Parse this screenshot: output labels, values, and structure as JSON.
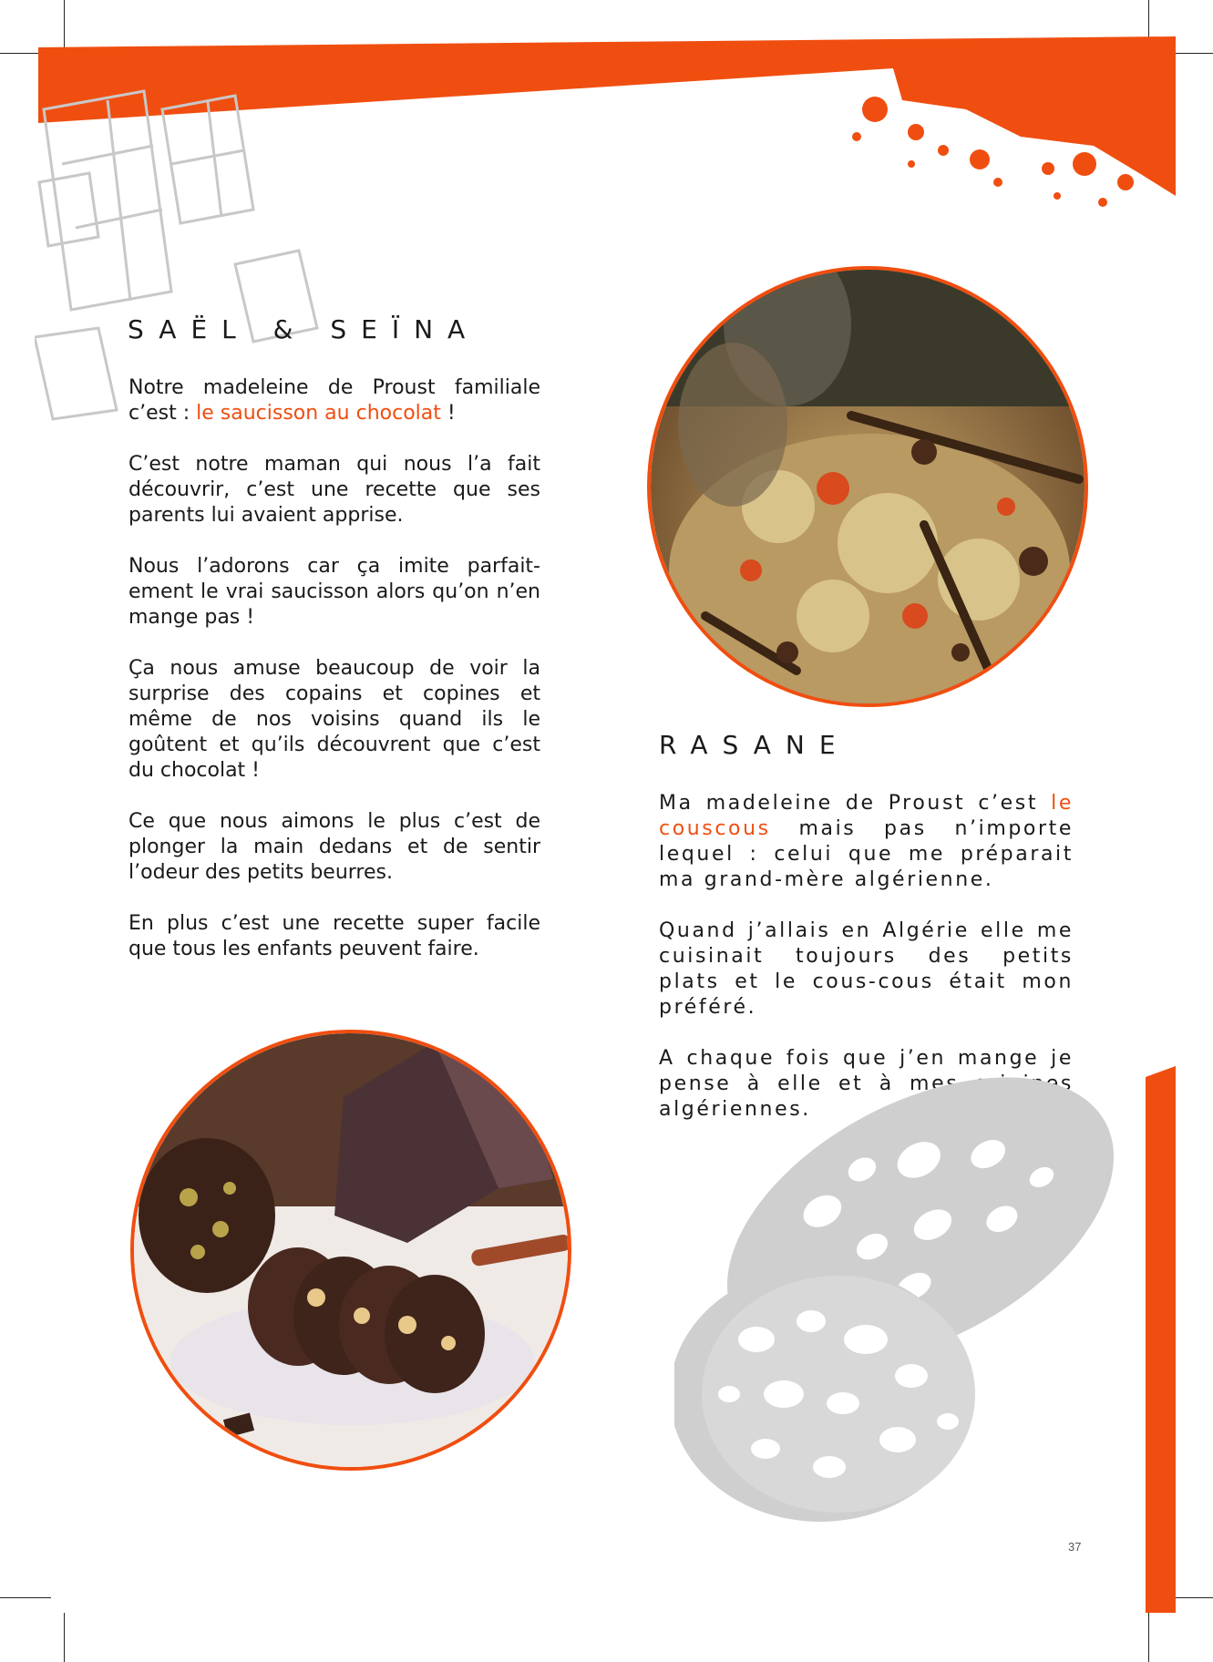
{
  "colors": {
    "accent": "#f04e10",
    "text": "#1a1a1a",
    "decor": "#d0d0d0"
  },
  "left": {
    "title": "SAËL & SEÏNA",
    "paragraph_1_before": "Notre madeleine de Proust familiale c’est : ",
    "paragraph_1_highlight": "le saucisson au chocolat",
    "paragraph_1_after": " !",
    "paragraph_2": "C’est notre maman qui nous l’a fait découvrir, c’est une recette que ses parents lui avaient apprise.",
    "paragraph_3": "Nous l’adorons car ça imite parfait-ement le vrai saucisson alors qu’on n’en mange pas !",
    "paragraph_4": "Ça nous amuse beaucoup de voir la surprise des copains et copines et même de nos voisins quand ils le goûtent et qu’ils découvrent que c’est du chocolat !",
    "paragraph_5": "Ce que nous aimons le plus c’est de plonger la main dedans et de sentir l’odeur des petits beurres.",
    "paragraph_6": "En plus c’est une recette super facile que tous les enfants peuvent faire."
  },
  "right": {
    "title": "RASANE",
    "paragraph_1_before": "Ma madeleine de Proust c’est ",
    "paragraph_1_highlight": "le couscous",
    "paragraph_1_after": " mais pas n’importe lequel : celui que me préparait ma grand-mère algérienne.",
    "paragraph_2": "Quand j’allais en Algérie elle me cuisinait toujours des petits plats et le cous-cous était mon préféré.",
    "paragraph_3": "A chaque fois que j’en mange je pense à elle et à mes origines algériennes."
  },
  "page_number": "37"
}
